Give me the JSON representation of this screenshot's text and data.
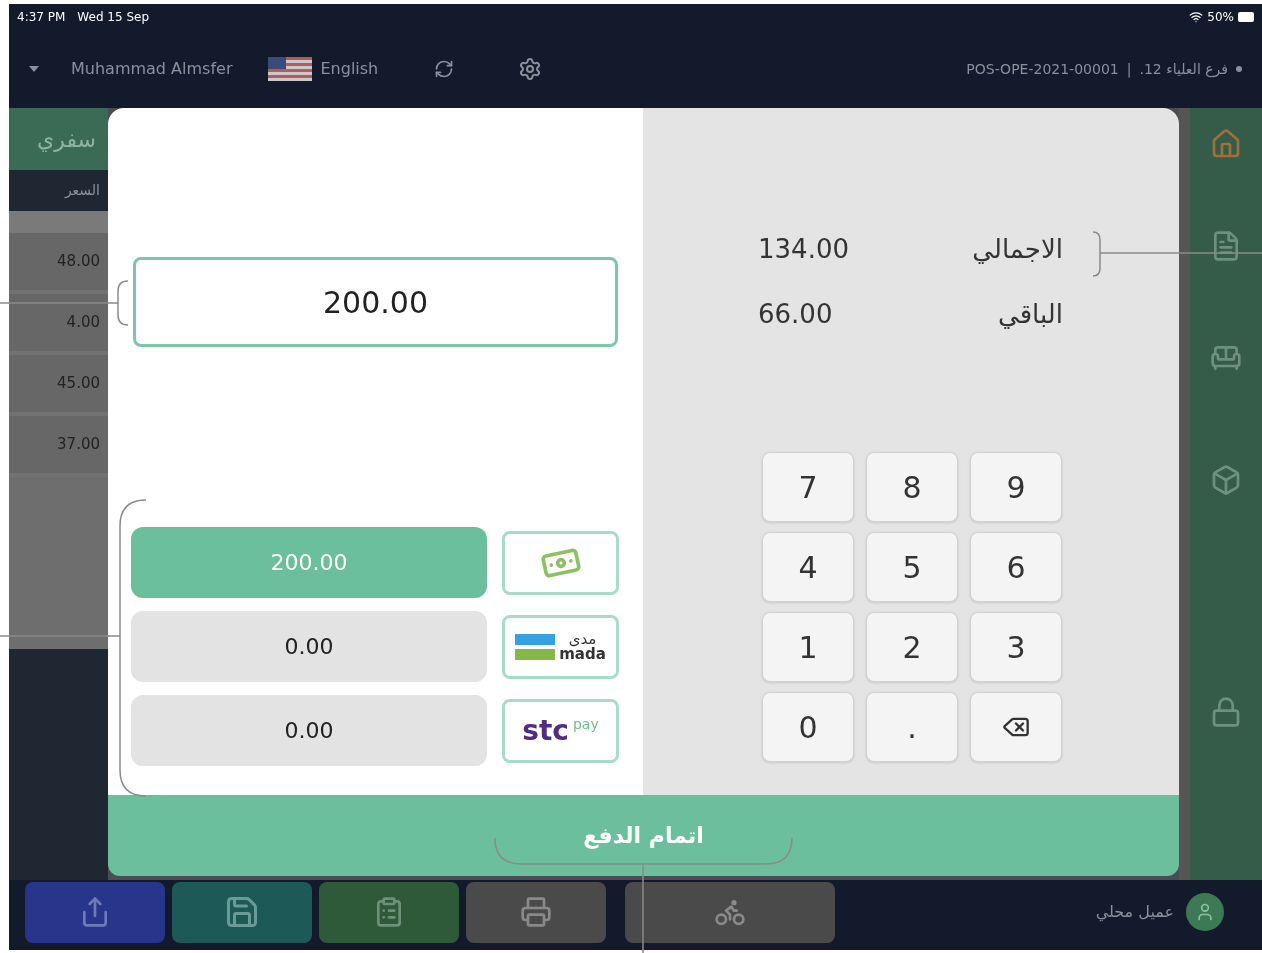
{
  "status_bar": {
    "time": "4:37 PM",
    "date": "Wed 15 Sep",
    "battery": "50%"
  },
  "header": {
    "user": "Muhammad Almsfer",
    "language": "English",
    "register": "POS-OPE-2021-00001",
    "separator": "|",
    "branch": "فرع العلياء 12."
  },
  "order_panel": {
    "tab": "سفري",
    "column": "السعر",
    "prices": [
      "48.00",
      "4.00",
      "45.00",
      "37.00"
    ]
  },
  "payment_dialog": {
    "amount_input": "200.00",
    "methods": [
      {
        "kind": "cash",
        "amount": "200.00",
        "selected": true
      },
      {
        "kind": "mada",
        "amount": "0.00",
        "selected": false,
        "logo_ar": "مدى",
        "logo_en": "mada"
      },
      {
        "kind": "stcpay",
        "amount": "0.00",
        "selected": false,
        "logo_main": "stc",
        "logo_sub": "pay"
      }
    ],
    "summary": [
      {
        "label": "الاجمالي",
        "value": "134.00"
      },
      {
        "label": "الباقي",
        "value": "66.00"
      }
    ],
    "keypad": [
      {
        "kind": "key",
        "label": "7"
      },
      {
        "kind": "key",
        "label": "8"
      },
      {
        "kind": "key",
        "label": "9"
      },
      {
        "kind": "key",
        "label": "4"
      },
      {
        "kind": "key",
        "label": "5"
      },
      {
        "kind": "key",
        "label": "6"
      },
      {
        "kind": "key",
        "label": "1"
      },
      {
        "kind": "key",
        "label": "2"
      },
      {
        "kind": "key",
        "label": "3"
      },
      {
        "kind": "key",
        "label": "0"
      },
      {
        "kind": "key",
        "label": "."
      },
      {
        "kind": "backspace"
      }
    ],
    "submit": "اتمام الدفع"
  },
  "bottom_bar": {
    "customer": "عميل محلي"
  }
}
